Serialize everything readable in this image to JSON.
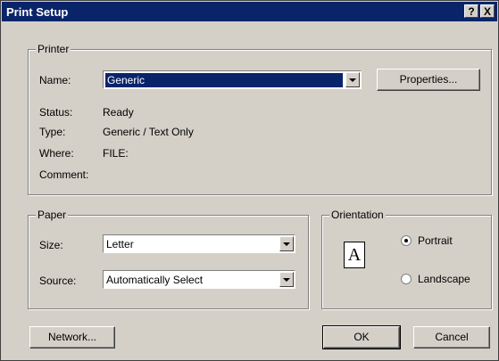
{
  "window": {
    "title": "Print Setup",
    "help_glyph": "?",
    "close_glyph": "X"
  },
  "printer": {
    "legend": "Printer",
    "name_label": "Name:",
    "name_value": "Generic",
    "properties_label": "Properties...",
    "status_label": "Status:",
    "status_value": "Ready",
    "type_label": "Type:",
    "type_value": "Generic / Text Only",
    "where_label": "Where:",
    "where_value": "FILE:",
    "comment_label": "Comment:",
    "comment_value": ""
  },
  "paper": {
    "legend": "Paper",
    "size_label": "Size:",
    "size_value": "Letter",
    "source_label": "Source:",
    "source_value": "Automatically Select"
  },
  "orientation": {
    "legend": "Orientation",
    "portrait_label": "Portrait",
    "landscape_label": "Landscape",
    "selected": "Portrait",
    "page_glyph": "A"
  },
  "buttons": {
    "network": "Network...",
    "ok": "OK",
    "cancel": "Cancel"
  },
  "icons": {
    "help": "help-icon",
    "close": "close-icon",
    "dropdown": "chevron-down-icon",
    "page": "page-portrait-icon"
  }
}
